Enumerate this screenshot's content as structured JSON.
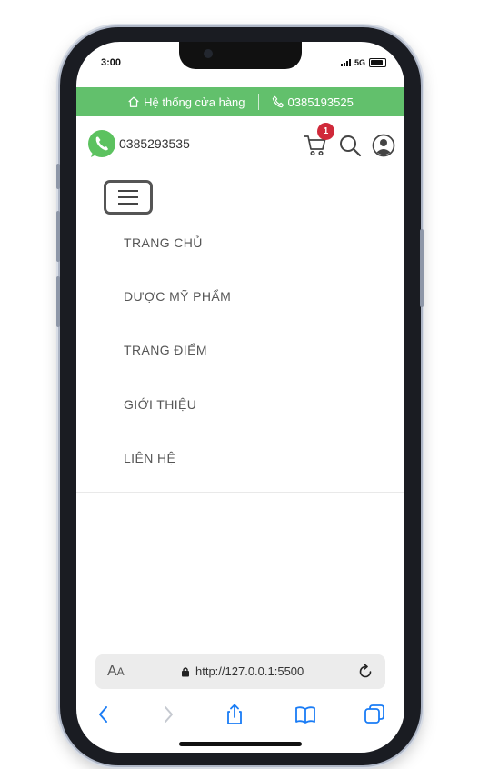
{
  "status_bar": {
    "time": "3:00",
    "network": "5G"
  },
  "top_bar": {
    "store_link": "Hệ thống cửa hàng",
    "hotline": "0385193525",
    "background_color": "#62c06c"
  },
  "header": {
    "whatsapp_phone": "0385293535",
    "cart_count": "1",
    "badge_color": "#d0293a"
  },
  "menu": {
    "items": [
      {
        "label": "TRANG CHỦ"
      },
      {
        "label": "DƯỢC MỸ PHẨM"
      },
      {
        "label": "TRANG ĐIỂM"
      },
      {
        "label": "GIỚI THIỆU"
      },
      {
        "label": "LIÊN HỆ"
      }
    ]
  },
  "browser": {
    "text_size_label": "A",
    "text_size_label_small": "A",
    "url": "http://127.0.0.1:5500",
    "accent_color": "#1a7cf5"
  },
  "icons": [
    "home-icon",
    "phone-icon",
    "whatsapp-icon",
    "cart-icon",
    "search-icon",
    "user-icon",
    "hamburger-icon",
    "lock-icon",
    "reload-icon",
    "back-icon",
    "forward-icon",
    "share-icon",
    "bookmarks-icon",
    "tabs-icon"
  ]
}
